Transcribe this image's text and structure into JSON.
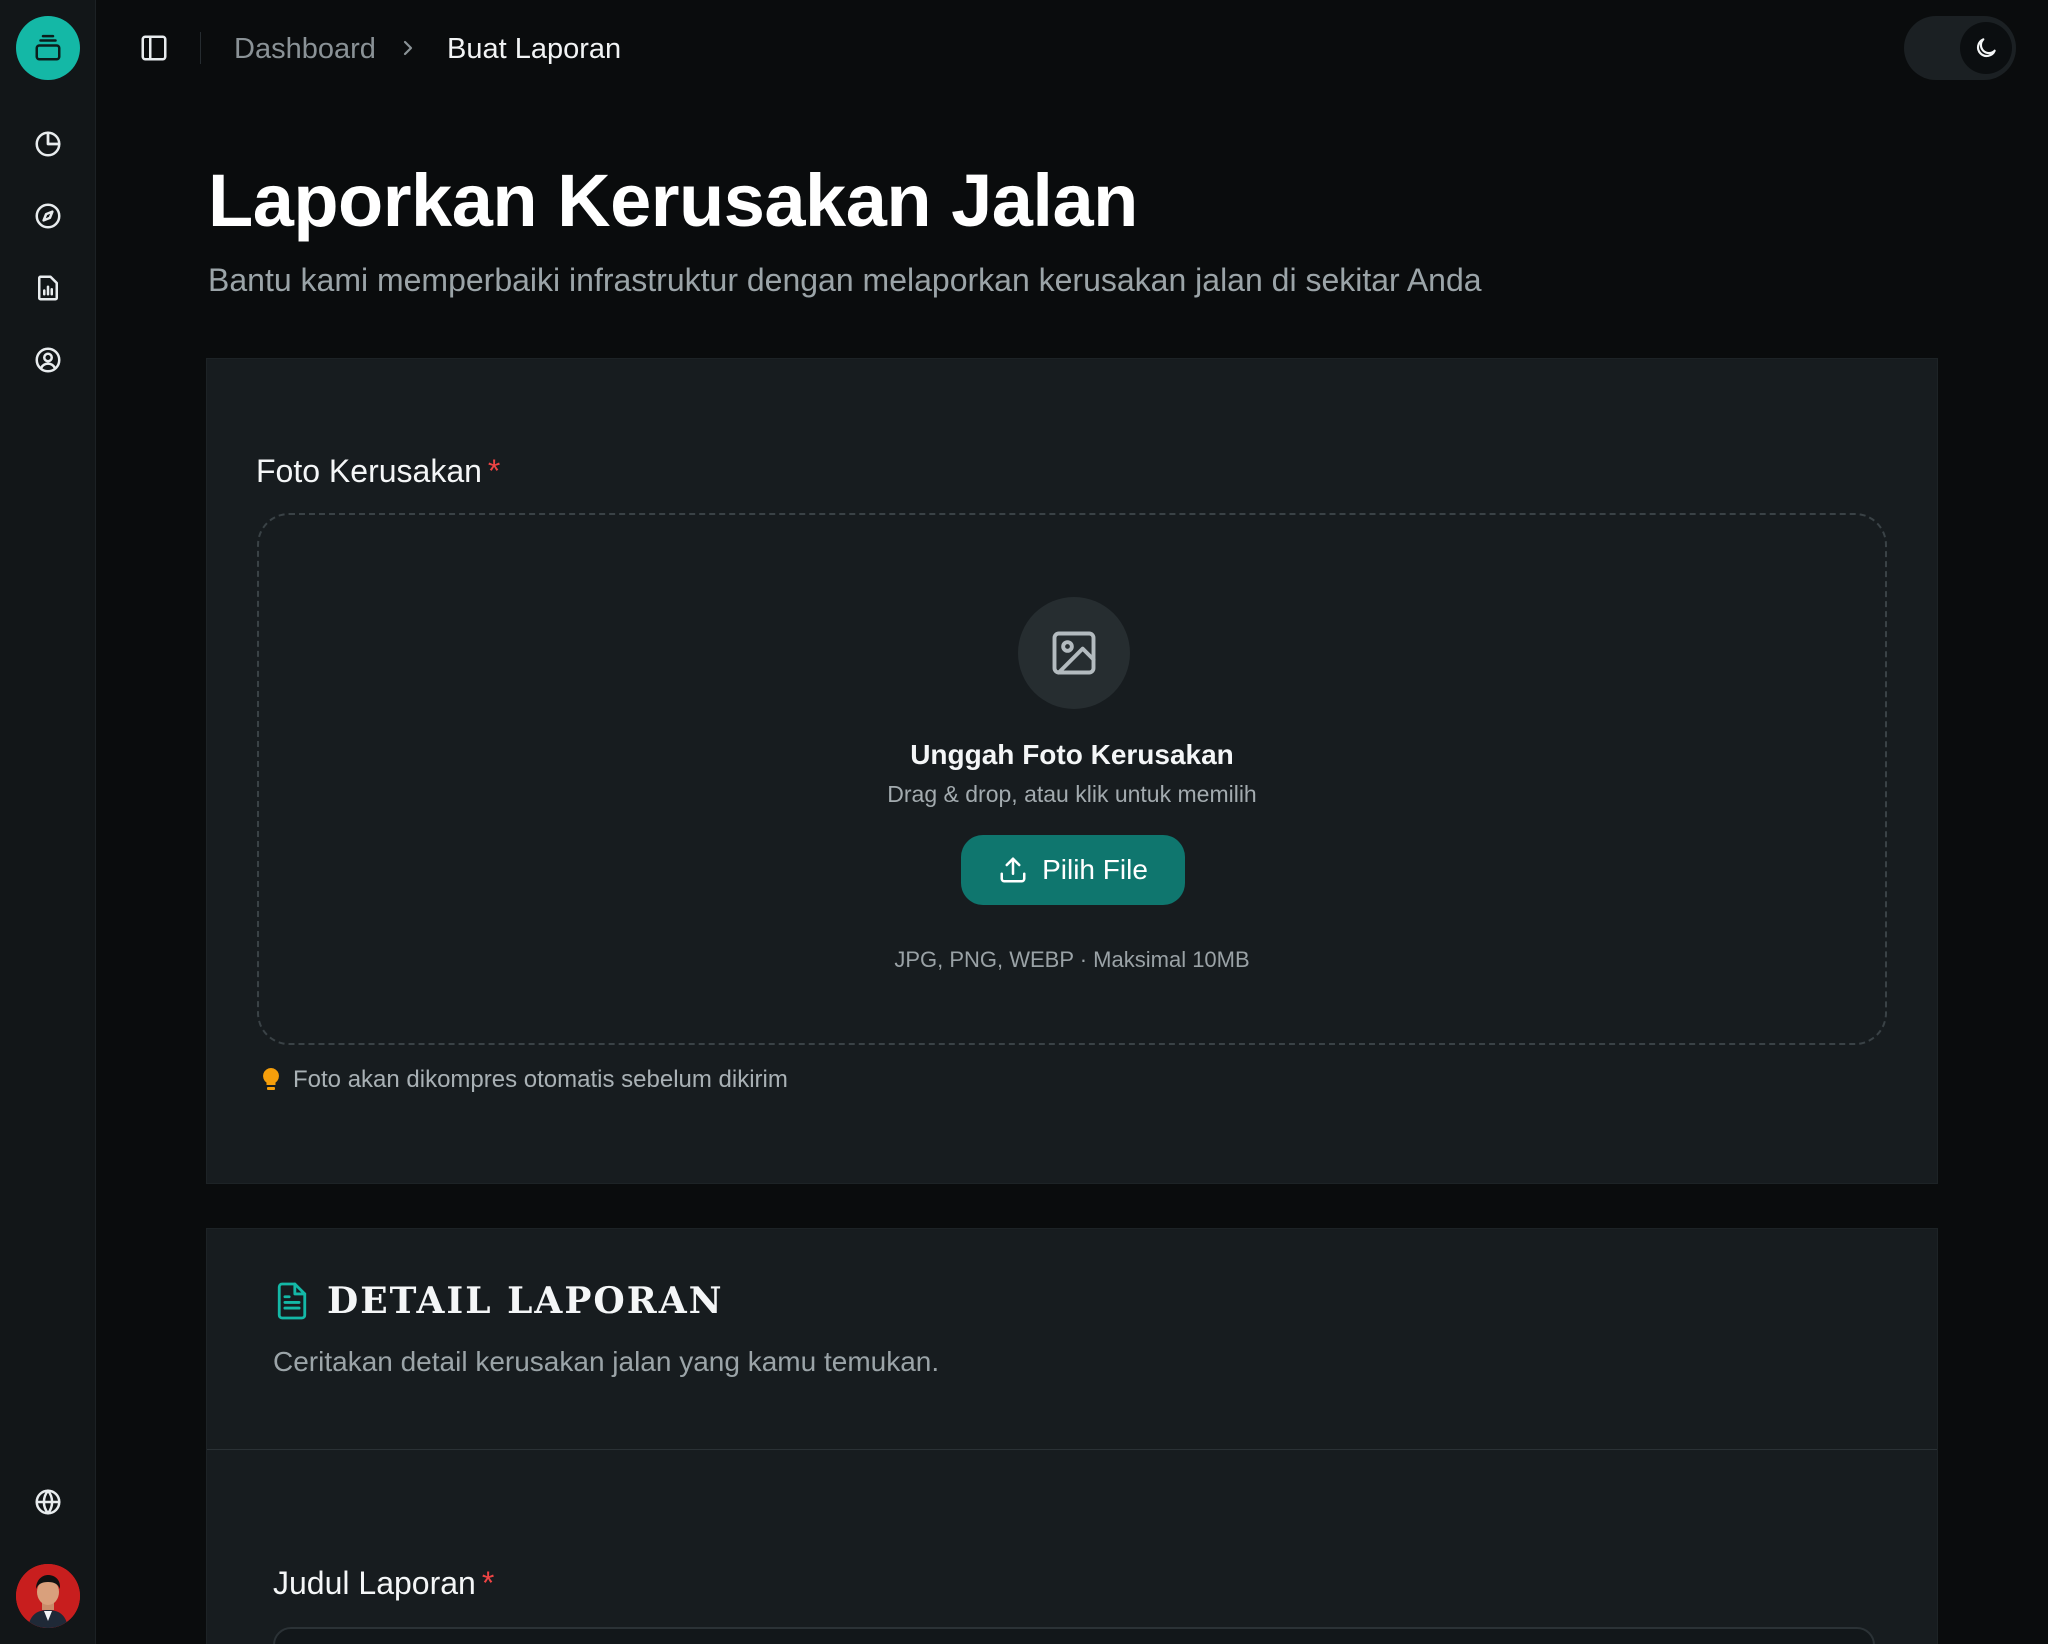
{
  "breadcrumb": {
    "parent": "Dashboard",
    "current": "Buat Laporan"
  },
  "header": {
    "title": "Laporkan Kerusakan Jalan",
    "subtitle": "Bantu kami memperbaiki infrastruktur dengan melaporkan kerusakan jalan di sekitar Anda"
  },
  "photo_section": {
    "label": "Foto Kerusakan",
    "required_mark": "*",
    "upload_title": "Unggah Foto Kerusakan",
    "upload_hint": "Drag & drop, atau klik untuk memilih",
    "button_label": "Pilih File",
    "formats": "JPG, PNG, WEBP · Maksimal 10MB",
    "tip": "Foto akan dikompres otomatis sebelum dikirim"
  },
  "detail_section": {
    "title": "DETAIL LAPORAN",
    "subtitle": "Ceritakan detail kerusakan jalan yang kamu temukan.",
    "judul_label": "Judul Laporan",
    "required_mark": "*"
  },
  "sidebar": {
    "icons": [
      "pie-chart-icon",
      "compass-icon",
      "report-icon",
      "user-circle-icon",
      "globe-icon"
    ]
  },
  "colors": {
    "accent": "#14b8a6",
    "button": "#0f766e",
    "required": "#ef4444",
    "tip_icon": "#f59e0b"
  }
}
